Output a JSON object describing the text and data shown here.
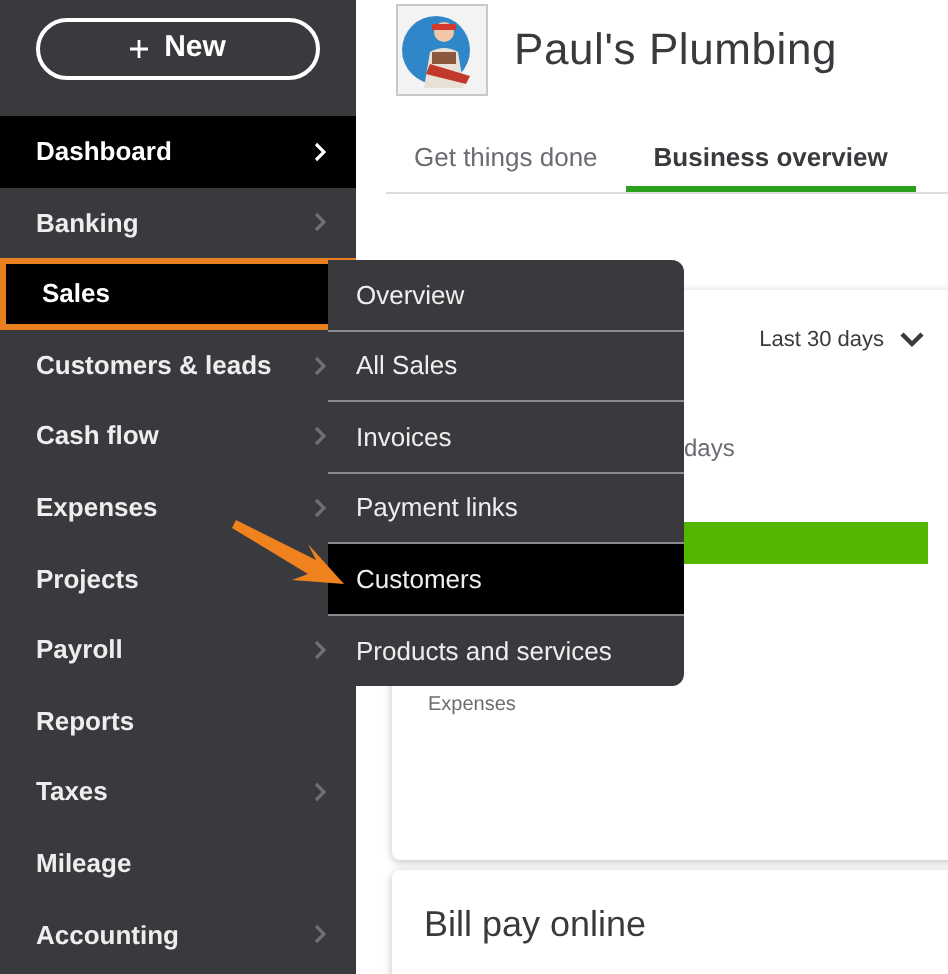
{
  "new_button": {
    "label": "New"
  },
  "sidebar": {
    "items": [
      {
        "label": "Dashboard",
        "selected": true,
        "highlighted": false,
        "submenu": true
      },
      {
        "label": "Banking",
        "selected": false,
        "highlighted": false,
        "submenu": true
      },
      {
        "label": "Sales",
        "selected": true,
        "highlighted": true,
        "submenu": false
      },
      {
        "label": "Customers & leads",
        "selected": false,
        "highlighted": false,
        "submenu": true
      },
      {
        "label": "Cash flow",
        "selected": false,
        "highlighted": false,
        "submenu": true
      },
      {
        "label": "Expenses",
        "selected": false,
        "highlighted": false,
        "submenu": true
      },
      {
        "label": "Projects",
        "selected": false,
        "highlighted": false,
        "submenu": false
      },
      {
        "label": "Payroll",
        "selected": false,
        "highlighted": false,
        "submenu": true
      },
      {
        "label": "Reports",
        "selected": false,
        "highlighted": false,
        "submenu": false
      },
      {
        "label": "Taxes",
        "selected": false,
        "highlighted": false,
        "submenu": true
      },
      {
        "label": "Mileage",
        "selected": false,
        "highlighted": false,
        "submenu": false
      },
      {
        "label": "Accounting",
        "selected": false,
        "highlighted": false,
        "submenu": true
      }
    ]
  },
  "flyout_menu": {
    "items": [
      {
        "label": "Overview",
        "selected": false
      },
      {
        "label": "All Sales",
        "selected": false
      },
      {
        "label": "Invoices",
        "selected": false
      },
      {
        "label": "Payment links",
        "selected": false
      },
      {
        "label": "Customers",
        "selected": true
      },
      {
        "label": "Products and services",
        "selected": false
      }
    ]
  },
  "company": {
    "name": "Paul's Plumbing"
  },
  "tabs": [
    {
      "label": "Get things done",
      "selected": false
    },
    {
      "label": "Business overview",
      "selected": true
    }
  ],
  "overview_card": {
    "period": "Last 30 days",
    "subtitle": "days",
    "legend": "Expenses"
  },
  "bill_pay_card": {
    "title": "Bill pay online"
  }
}
